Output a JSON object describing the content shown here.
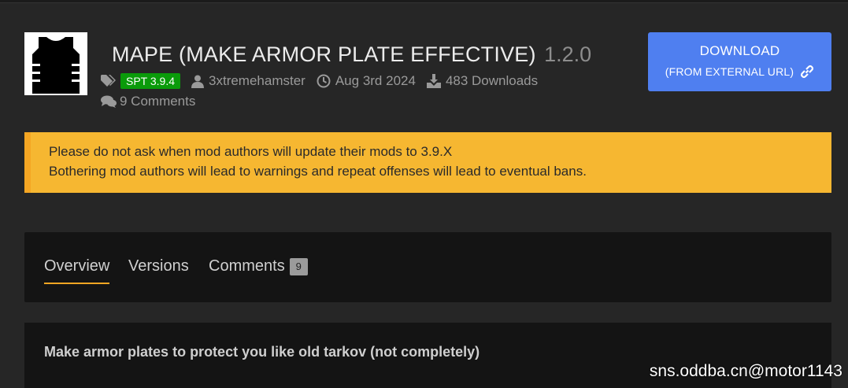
{
  "mod": {
    "title": "MAPE (MAKE ARMOR PLATE EFFECTIVE)",
    "version": "1.2.0",
    "spt_version": "SPT 3.9.4",
    "author": "3xtremehamster",
    "date": "Aug 3rd 2024",
    "downloads": "483 Downloads",
    "comments": "9 Comments"
  },
  "download_button": {
    "label": "DOWNLOAD",
    "sublabel": "(FROM EXTERNAL URL)"
  },
  "warning": {
    "line1": "Please do not ask when mod authors will update their mods to 3.9.X",
    "line2": "Bothering mod authors will lead to warnings and repeat offenses will lead to eventual bans."
  },
  "tabs": [
    {
      "label": "Overview",
      "active": true
    },
    {
      "label": "Versions"
    },
    {
      "label": "Comments",
      "badge": "9"
    }
  ],
  "description": {
    "headline": "Make armor plates to protect you like old tarkov (not completely)"
  },
  "watermark": "sns.oddba.cn@motor1143",
  "colors": {
    "background": "#262626",
    "panel": "#141414",
    "accent_blue": "#4f7ff0",
    "warning_yellow": "#f6b731",
    "tab_underline": "#f5a623",
    "spt_badge_green": "#0a9b0a"
  },
  "icons": [
    "tags-icon",
    "user-icon",
    "clock-icon",
    "download-icon",
    "comments-icon",
    "link-icon",
    "vest-icon"
  ]
}
